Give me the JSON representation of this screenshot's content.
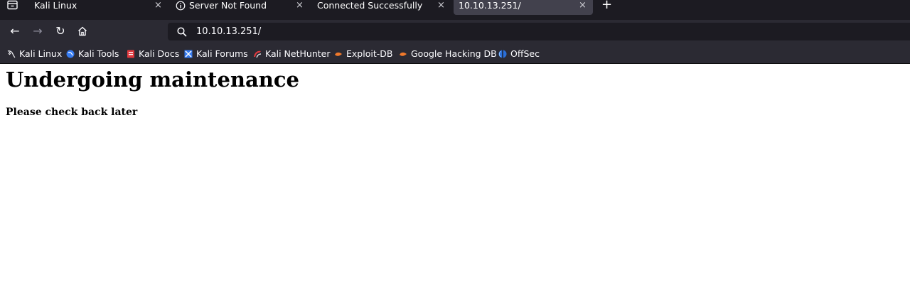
{
  "browser": {
    "tabs": [
      {
        "label": "Kali Linux",
        "active": false
      },
      {
        "label": "Server Not Found",
        "active": false
      },
      {
        "label": "Connected Successfully",
        "active": false
      },
      {
        "label": "10.10.13.251/",
        "active": true
      }
    ],
    "new_tab_glyph": "+",
    "close_glyph": "×",
    "nav": {
      "back_glyph": "←",
      "forward_glyph": "→",
      "reload_glyph": "↻",
      "home_icon": "home-icon"
    },
    "url": "10.10.13.251/",
    "bookmarks": [
      {
        "label": "Kali Linux",
        "icon": "kali-dragon-icon"
      },
      {
        "label": "Kali Tools",
        "icon": "kali-tools-icon"
      },
      {
        "label": "Kali Docs",
        "icon": "kali-docs-icon"
      },
      {
        "label": "Kali Forums",
        "icon": "kali-forums-icon"
      },
      {
        "label": "Kali NetHunter",
        "icon": "nethunter-icon"
      },
      {
        "label": "Exploit-DB",
        "icon": "exploit-db-icon"
      },
      {
        "label": "Google Hacking DB",
        "icon": "ghdb-icon"
      },
      {
        "label": "OffSec",
        "icon": "offsec-icon"
      }
    ]
  },
  "page": {
    "heading": "Undergoing maintenance",
    "subheading": "Please check back later"
  },
  "colors": {
    "tabbar_bg": "#1c1b22",
    "toolbar_bg": "#2b2a33",
    "active_tab_bg": "#42414d",
    "urlbar_bg": "#1c1b22",
    "text_light": "#fbfbfe"
  }
}
